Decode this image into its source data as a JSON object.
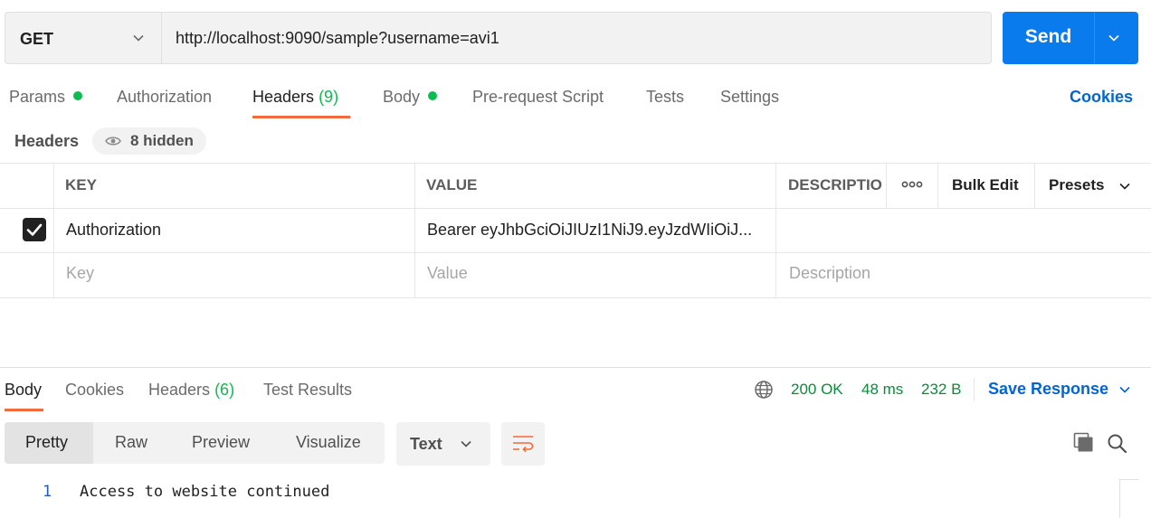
{
  "request": {
    "method": "GET",
    "url": "http://localhost:9090/sample?username=avi1",
    "send_label": "Send"
  },
  "tabs": {
    "params": "Params",
    "authorization": "Authorization",
    "headers": "Headers",
    "headers_count": "(9)",
    "body": "Body",
    "prerequest": "Pre-request Script",
    "tests": "Tests",
    "settings": "Settings",
    "cookies": "Cookies"
  },
  "headers_section": {
    "title": "Headers",
    "hidden": "8 hidden"
  },
  "table": {
    "col_key": "KEY",
    "col_value": "VALUE",
    "col_description": "DESCRIPTIO",
    "more": "ooo",
    "bulk_edit": "Bulk Edit",
    "presets": "Presets",
    "rows": [
      {
        "key": "Authorization",
        "value": "Bearer eyJhbGciOiJIUzI1NiJ9.eyJzdWIiOiJ...",
        "checked": true
      }
    ],
    "placeholder_key": "Key",
    "placeholder_value": "Value",
    "placeholder_description": "Description"
  },
  "response": {
    "tabs": {
      "body": "Body",
      "cookies": "Cookies",
      "headers": "Headers",
      "headers_count": "(6)",
      "test_results": "Test Results"
    },
    "status": "200 OK",
    "time": "48 ms",
    "size": "232 B",
    "save_response": "Save Response",
    "views": {
      "pretty": "Pretty",
      "raw": "Raw",
      "preview": "Preview",
      "visualize": "Visualize"
    },
    "format": "Text",
    "lines": [
      {
        "number": "1",
        "text": "Access to website continued"
      }
    ]
  },
  "colors": {
    "accent": "#097bed",
    "tab_underline": "#f26b3a",
    "success": "#0cbb52",
    "link": "#0265d2"
  }
}
